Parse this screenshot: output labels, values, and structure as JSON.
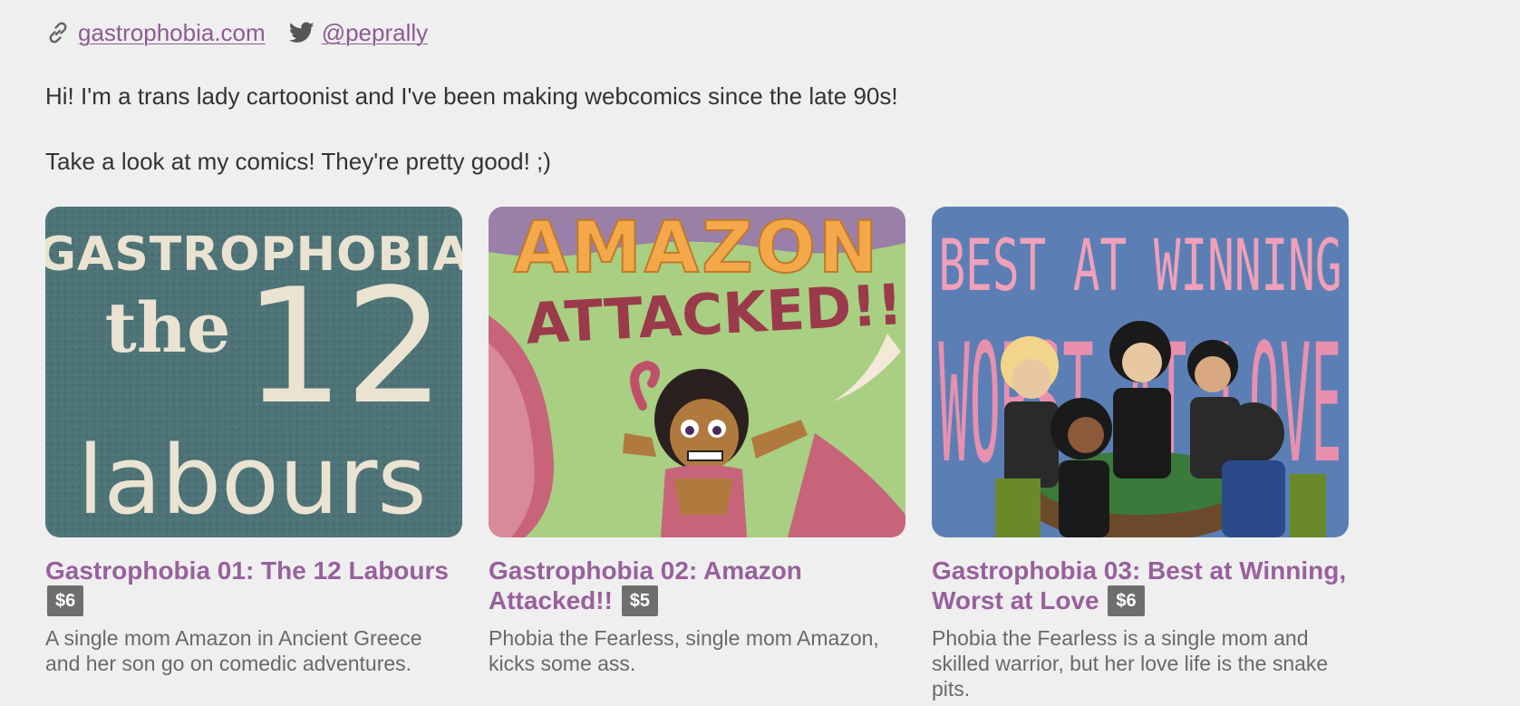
{
  "links": {
    "website": "gastrophobia.com",
    "twitter": "@peprally"
  },
  "bio": {
    "line1": "Hi! I'm a trans lady cartoonist and I've been making webcomics since the late 90s!",
    "line2": "Take a look at my comics! They're pretty good! ;)"
  },
  "comics": [
    {
      "title": "Gastrophobia 01: The 12 Labours",
      "price": "$6",
      "description": "A single mom Amazon in Ancient Greece and her son go on comedic adventures.",
      "cover_text": [
        "GASTROPHOBIA",
        "the",
        "12",
        "labours"
      ],
      "cover_bg": "#4e7478"
    },
    {
      "title": "Gastrophobia 02: Amazon Attacked!!",
      "price": "$5",
      "description": "Phobia the Fearless, single mom Amazon, kicks some ass.",
      "cover_text": [
        "AMAZON",
        "ATTACKED!!"
      ],
      "cover_bg": "#a8cf82"
    },
    {
      "title": "Gastrophobia 03: Best at Winning, Worst at Love",
      "price": "$6",
      "description": "Phobia the Fearless is a single mom and skilled warrior, but her love life is the snake pits.",
      "cover_text": [
        "BEST AT WINNING",
        "WORST AT LOVE"
      ],
      "cover_bg": "#5b7fb5"
    }
  ],
  "colors": {
    "link": "#8e5a94",
    "title": "#98609d",
    "price_bg": "#6e6e6e",
    "background": "#efefef"
  }
}
